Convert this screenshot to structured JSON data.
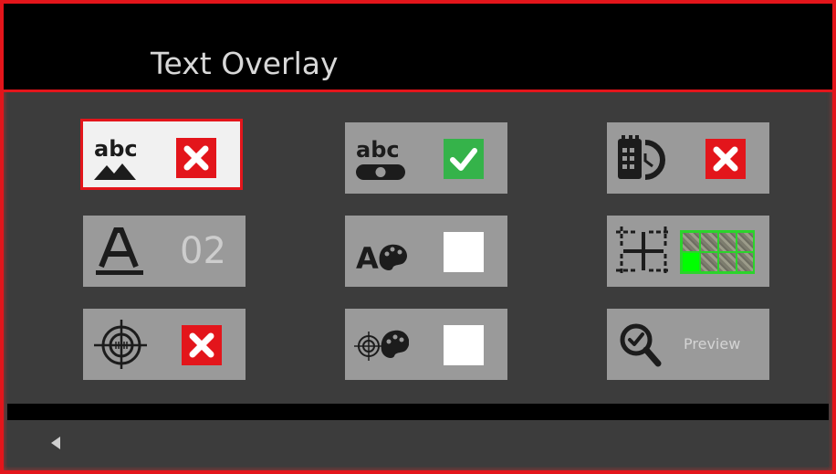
{
  "header": {
    "title": "Text Overlay"
  },
  "tiles": [
    {
      "name": "text-image-overlay-tile",
      "icon": "abc-mountains-icon",
      "state": "disabled",
      "selected": true
    },
    {
      "name": "text-toggle-tile",
      "icon": "abc-toggle-icon",
      "state": "enabled"
    },
    {
      "name": "date-time-overlay-tile",
      "icon": "calendar-clock-icon",
      "state": "disabled"
    },
    {
      "name": "font-size-tile",
      "icon": "font-size-icon",
      "value": "02"
    },
    {
      "name": "text-color-tile",
      "icon": "text-palette-icon",
      "color": "#ffffff"
    },
    {
      "name": "position-grid-tile",
      "icon": "position-grid-icon",
      "preview": "grid-position-thumbnail"
    },
    {
      "name": "crosshair-overlay-tile",
      "icon": "crosshair-icon",
      "state": "disabled"
    },
    {
      "name": "crosshair-color-tile",
      "icon": "crosshair-palette-icon",
      "color": "#ffffff"
    },
    {
      "name": "preview-tile",
      "icon": "magnify-check-icon",
      "label": "Preview"
    }
  ],
  "footer": {
    "back_icon": "back-arrow-icon"
  },
  "colors": {
    "accent": "#e3151b",
    "tile": "#9a9a9a",
    "tile_selected": "#f1f1f1",
    "enabled": "#35b34a",
    "disabled": "#e3151b",
    "grid_highlight": "#2bd42b"
  }
}
